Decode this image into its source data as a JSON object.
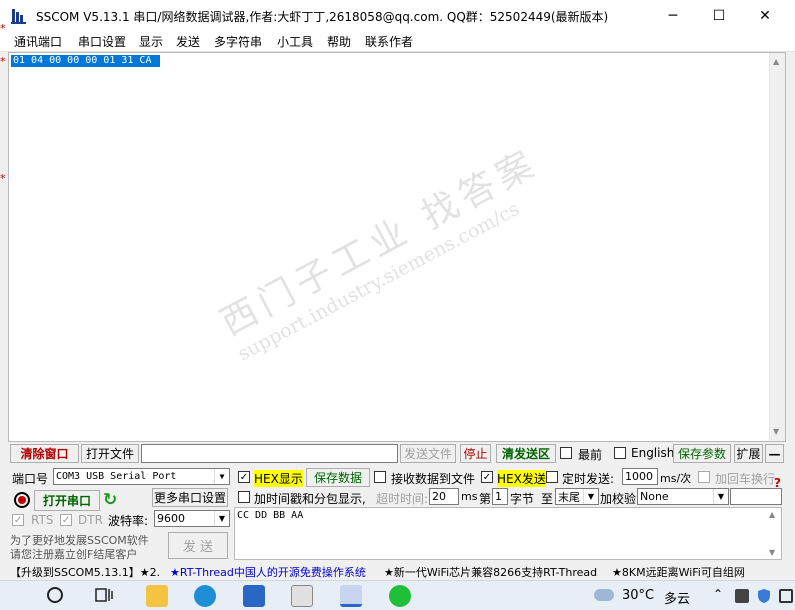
{
  "window": {
    "title": "SSCOM V5.13.1 串口/网络数据调试器,作者:大虾丁丁,2618058@qq.com. QQ群：52502449(最新版本)",
    "controls": [
      "─",
      "☐",
      "✕"
    ]
  },
  "menu": [
    "通讯端口",
    "串口设置",
    "显示",
    "发送",
    "多字符串",
    "小工具",
    "帮助",
    "联系作者"
  ],
  "receive": {
    "text": "01 04 00 00 00 01 31 CA "
  },
  "watermark": {
    "text": "西门子工业  找答案",
    "url": "support.industry.siemens.com/cs"
  },
  "toolbar": {
    "clear_window": "清除窗口",
    "open_file": "打开文件",
    "file_path": "",
    "send_file": "发送文件",
    "stop": "停止",
    "clear_send": "清发送区",
    "topmost": "最前",
    "english": "English",
    "save_params": "保存参数",
    "expand": "扩展",
    "collapse": "—"
  },
  "port": {
    "port_label": "端口号",
    "port_value": "COM3 USB Serial Port",
    "open_button": "打开串口",
    "more_settings": "更多串口设置",
    "rts": "RTS",
    "dtr": "DTR",
    "baud_label": "波特率:",
    "baud_value": "9600"
  },
  "options": {
    "hex_display": "HEX显示",
    "save_data": "保存数据",
    "recv_to_file": "接收数据到文件",
    "hex_send": "HEX发送",
    "timed_send": "定时发送:",
    "interval_value": "1000",
    "interval_unit": "ms/次",
    "append_crlf": "加回车换行",
    "timestamp": "加时间戳和分包显示,",
    "timeout_label": "超时时间:",
    "timeout_value": "20",
    "timeout_unit": "ms",
    "nth_label": "第",
    "nth_value": "1",
    "byte_label": "字节",
    "to_label": "至",
    "end_value": "末尾",
    "checksum_label": "加校验",
    "checksum_value": "None",
    "help_mark": "?"
  },
  "send": {
    "text": "CC DD BB AA",
    "button": "发 送"
  },
  "promo": {
    "line1": "为了更好地发展SSCOM软件",
    "line2": "请您注册嘉立创F结尾客户"
  },
  "marquee": {
    "item1": "【升级到SSCOM5.13.1】★2.",
    "item2": "★RT-Thread中国人的开源免费操作系统",
    "item3": "★新一代WiFi芯片兼容8266支持RT-Thread",
    "item4": "★8KM远距离WiFi可自组网"
  },
  "taskbar": {
    "weather_temp": "30°C",
    "weather_desc": "多云"
  },
  "colors": {
    "selection": "#0078d7",
    "red_button": "#b00000",
    "green_text": "#006400",
    "hex_highlight": "#ffff00",
    "marquee_blue": "#0000cc"
  }
}
